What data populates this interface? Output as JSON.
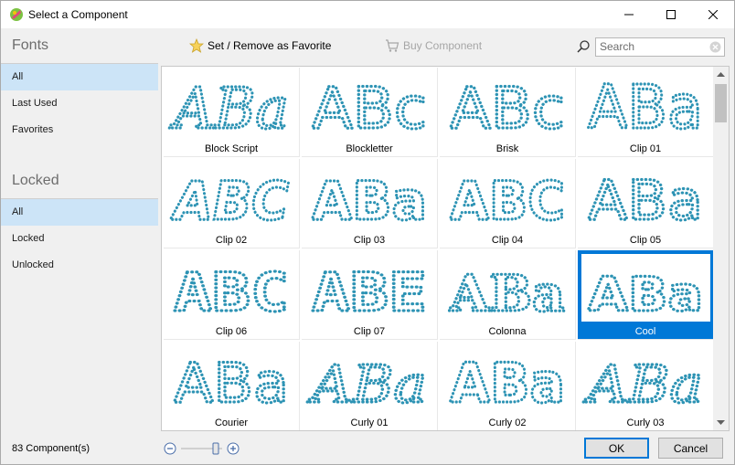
{
  "window": {
    "title": "Select a Component"
  },
  "sidebar": {
    "fonts_header": "Fonts",
    "fonts_items": [
      "All",
      "Last Used",
      "Favorites"
    ],
    "locked_header": "Locked",
    "locked_items": [
      "All",
      "Locked",
      "Unlocked"
    ]
  },
  "toolbar": {
    "favorite_label": "Set / Remove as Favorite",
    "buy_label": "Buy Component",
    "search_placeholder": "Search"
  },
  "grid": {
    "items": [
      {
        "label": "Block Script",
        "sample": "ABa"
      },
      {
        "label": "Blockletter",
        "sample": "ABc"
      },
      {
        "label": "Brisk",
        "sample": "ABc"
      },
      {
        "label": "Clip 01",
        "sample": "ABa"
      },
      {
        "label": "Clip 02",
        "sample": "ABC"
      },
      {
        "label": "Clip 03",
        "sample": "ABa"
      },
      {
        "label": "Clip 04",
        "sample": "ABC"
      },
      {
        "label": "Clip 05",
        "sample": "ABa"
      },
      {
        "label": "Clip 06",
        "sample": "ABC"
      },
      {
        "label": "Clip 07",
        "sample": "ABE"
      },
      {
        "label": "Colonna",
        "sample": "ABa"
      },
      {
        "label": "Cool",
        "sample": "ABa"
      },
      {
        "label": "Courier",
        "sample": "ABa"
      },
      {
        "label": "Curly 01",
        "sample": "ABa"
      },
      {
        "label": "Curly 02",
        "sample": "ABa"
      },
      {
        "label": "Curly 03",
        "sample": "ABa"
      }
    ],
    "selected_label": "Cool"
  },
  "status": {
    "count": "83 Component(s)",
    "ok_label": "OK",
    "cancel_label": "Cancel"
  },
  "colors": {
    "accent": "#0078d7",
    "rhinestone": "#2d93b4",
    "sidebar_selected": "#cce4f7"
  }
}
